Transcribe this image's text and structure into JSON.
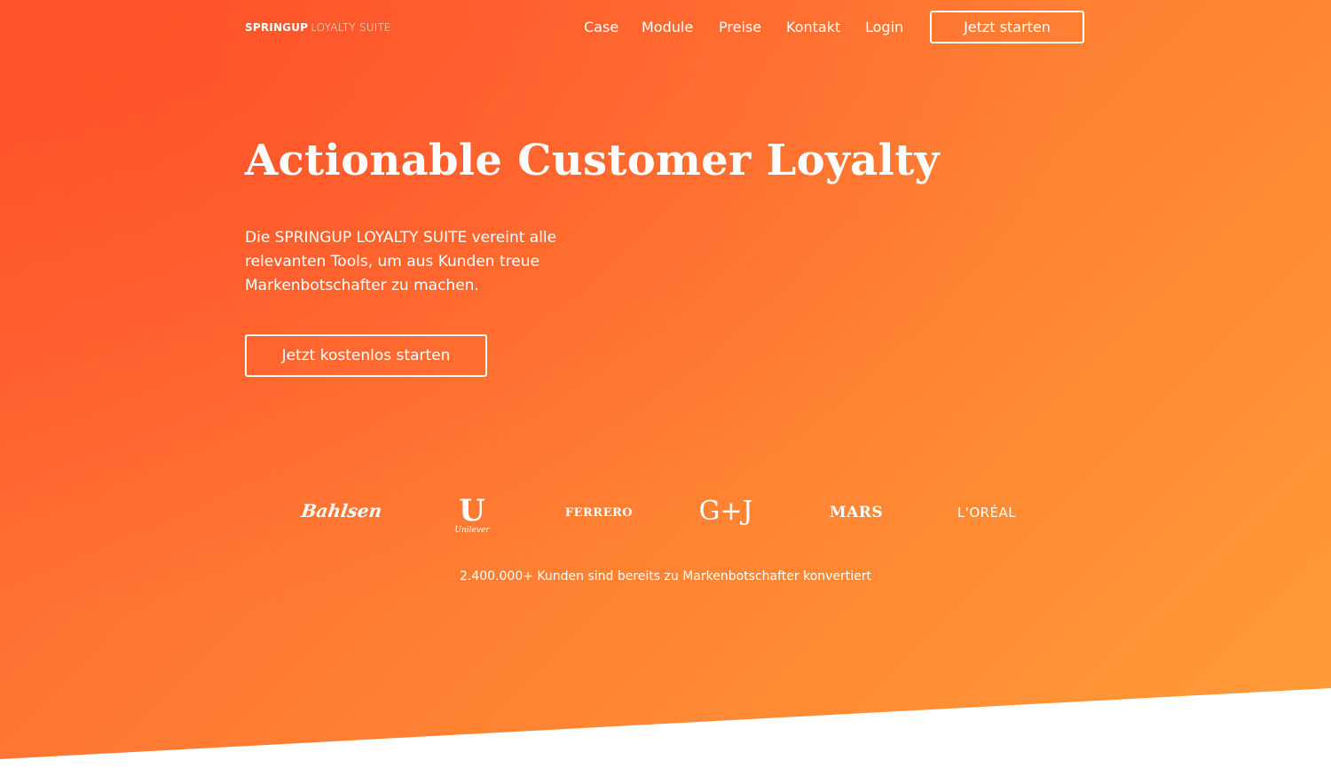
{
  "nav": {
    "brand_strong": "SPRINGUP",
    "brand_light": "LOYALTY SUITE",
    "links": [
      "Case",
      "Module",
      "Preise",
      "Kontakt",
      "Login"
    ],
    "cta_label": "Jetzt starten"
  },
  "hero": {
    "headline": "Actionable Customer Loyalty",
    "subtext": "Die SPRINGUP LOYALTY SUITE vereint alle relevanten Tools, um aus Kunden treue Markenbotschafter zu machen.",
    "cta_label": "Jetzt kostenlos starten"
  },
  "logos": {
    "bahlsen": "Bahlsen",
    "unilever_mark": "U",
    "unilever_word": "Unilever",
    "ferrero": "FERRERO",
    "gj": "G+J",
    "mars": "MARS",
    "loreal": "L'ORÉAL"
  },
  "stat_text": "2.400.000+ Kunden sind bereits zu Markenbotschafter konvertiert",
  "colors": {
    "gradient_start": "#ff5a2c",
    "gradient_end": "#ff9c38",
    "text": "#ffffff",
    "below_fold": "#ffffff"
  }
}
